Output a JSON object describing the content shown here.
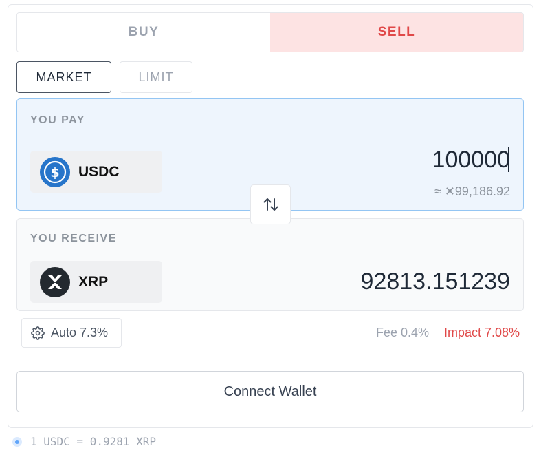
{
  "side_toggle": {
    "buy_label": "BUY",
    "sell_label": "SELL",
    "active": "SELL"
  },
  "order_type": {
    "market_label": "MARKET",
    "limit_label": "LIMIT",
    "active": "MARKET"
  },
  "pay": {
    "label": "YOU PAY",
    "token": "USDC",
    "token_icon": "usdc-coin-icon",
    "amount": "100000",
    "usd_value": "≈ ✕99,186.92"
  },
  "receive": {
    "label": "YOU RECEIVE",
    "token": "XRP",
    "token_icon": "xrp-coin-icon",
    "amount": "92813.151239"
  },
  "swap_icon": "swap-arrows-icon",
  "slippage": {
    "label": "Auto 7.3%",
    "icon": "gear-icon"
  },
  "fee_text": "Fee 0.4%",
  "impact_text": "Impact 7.08%",
  "connect_label": "Connect Wallet",
  "rate_text": "1 USDC = 0.9281 XRP",
  "colors": {
    "sell_active_bg": "#fde3e3",
    "sell_text": "#e04848",
    "pay_panel_bg": "#eef5fd",
    "pay_panel_border": "#93c5f3",
    "usdc_blue": "#2775ca",
    "xrp_dark": "#23292f",
    "impact_red": "#e04848"
  }
}
